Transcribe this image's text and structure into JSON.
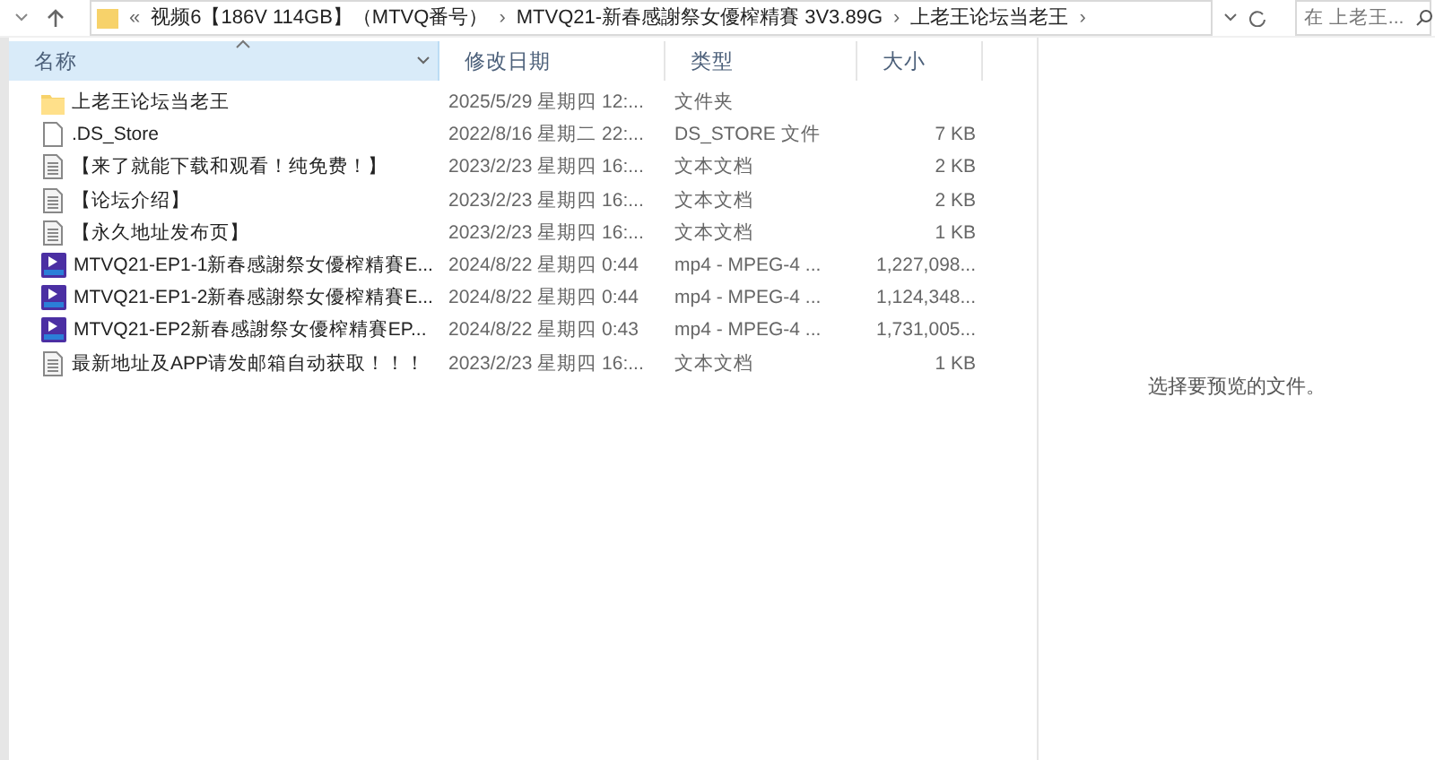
{
  "address_bar": {
    "crumbs": [
      {
        "kind": "overflow",
        "label": "«"
      },
      {
        "kind": "folder",
        "label": "视频6【186V 114GB】（MTVQ番号）"
      },
      {
        "kind": "separator",
        "label": "›"
      },
      {
        "kind": "folder",
        "label": "MTVQ21-新春感謝祭女優榨精賽  3V3.89G"
      },
      {
        "kind": "separator",
        "label": "›"
      },
      {
        "kind": "folder",
        "label": "上老王论坛当老王"
      },
      {
        "kind": "separator",
        "label": "›"
      }
    ]
  },
  "search": {
    "placeholder": "在 上老王..."
  },
  "table": {
    "columns": [
      {
        "label": "名称",
        "sorted": true
      },
      {
        "label": "修改日期",
        "sorted": false
      },
      {
        "label": "类型",
        "sorted": false
      },
      {
        "label": "大小",
        "sorted": false
      }
    ],
    "rows": [
      {
        "kind": "folder",
        "name": "上老王论坛当老王",
        "date": "2025/5/29 星期四 12:...",
        "type": "文件夹",
        "size": ""
      },
      {
        "kind": "file",
        "name": ".DS_Store",
        "date": "2022/8/16 星期二 22:...",
        "type": "DS_STORE 文件",
        "size": "7 KB"
      },
      {
        "kind": "text",
        "name": "【来了就能下载和观看！纯免费！】",
        "date": "2023/2/23 星期四 16:...",
        "type": "文本文档",
        "size": "2 KB"
      },
      {
        "kind": "text",
        "name": "【论坛介绍】",
        "date": "2023/2/23 星期四 16:...",
        "type": "文本文档",
        "size": "2 KB"
      },
      {
        "kind": "text",
        "name": "【永久地址发布页】",
        "date": "2023/2/23 星期四 16:...",
        "type": "文本文档",
        "size": "1 KB"
      },
      {
        "kind": "video",
        "name": "MTVQ21-EP1-1新春感謝祭女優榨精賽E...",
        "date": "2024/8/22 星期四 0:44",
        "type": "mp4 - MPEG-4 ...",
        "size": "1,227,098..."
      },
      {
        "kind": "video",
        "name": "MTVQ21-EP1-2新春感謝祭女優榨精賽E...",
        "date": "2024/8/22 星期四 0:44",
        "type": "mp4 - MPEG-4 ...",
        "size": "1,124,348..."
      },
      {
        "kind": "video",
        "name": "MTVQ21-EP2新春感謝祭女優榨精賽EP...",
        "date": "2024/8/22 星期四 0:43",
        "type": "mp4 - MPEG-4 ...",
        "size": "1,731,005..."
      },
      {
        "kind": "text",
        "name": "最新地址及APP请发邮箱自动获取！！！",
        "date": "2023/2/23 星期四 16:...",
        "type": "文本文档",
        "size": "1 KB"
      }
    ]
  },
  "preview": {
    "message": "选择要预览的文件。"
  }
}
